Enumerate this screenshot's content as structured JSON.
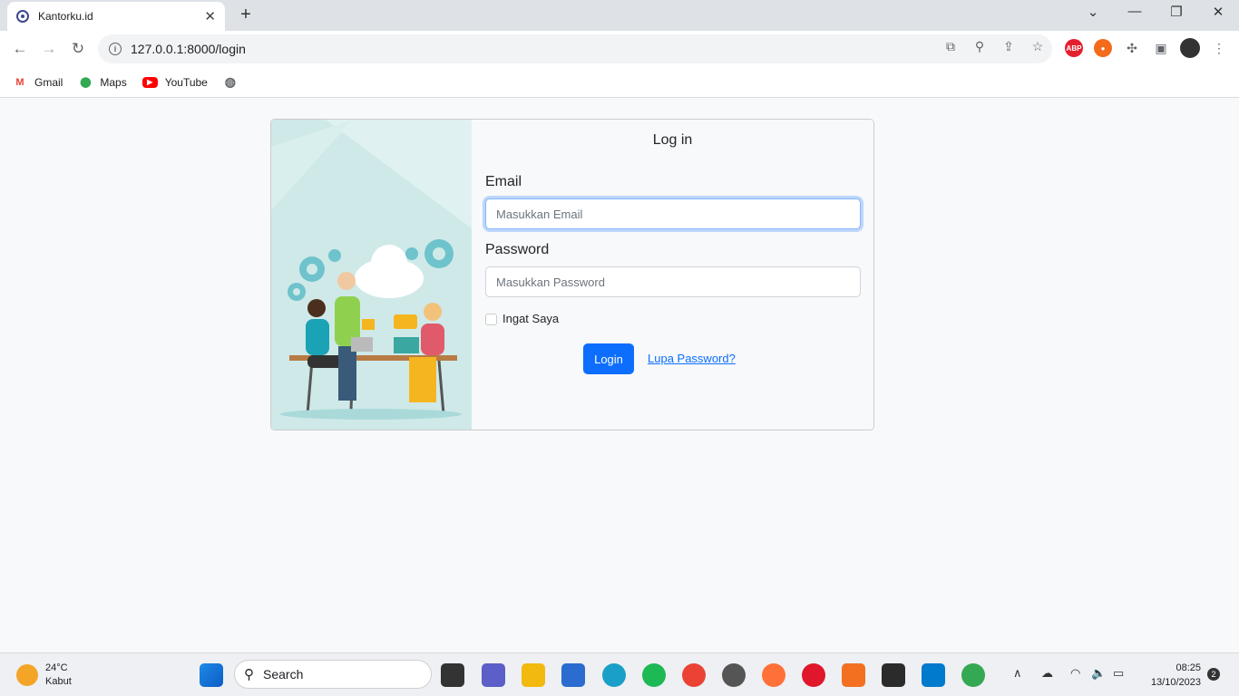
{
  "browser": {
    "tab_title": "Kantorku.id",
    "url": "127.0.0.1:8000/login",
    "bookmarks": [
      "Gmail",
      "Maps",
      "YouTube"
    ]
  },
  "login": {
    "title": "Log in",
    "email_label": "Email",
    "email_placeholder": "Masukkan Email",
    "password_label": "Password",
    "password_placeholder": "Masukkan Password",
    "remember_label": "Ingat Saya",
    "login_button": "Login",
    "forgot_link": "Lupa Password?"
  },
  "taskbar": {
    "temperature": "24°C",
    "weather": "Kabut",
    "search_label": "Search",
    "time": "08:25",
    "date": "13/10/2023",
    "notification_count": "2"
  },
  "colors": {
    "primary": "#0d6efd",
    "illustration_bg": "#cfe9e8"
  }
}
